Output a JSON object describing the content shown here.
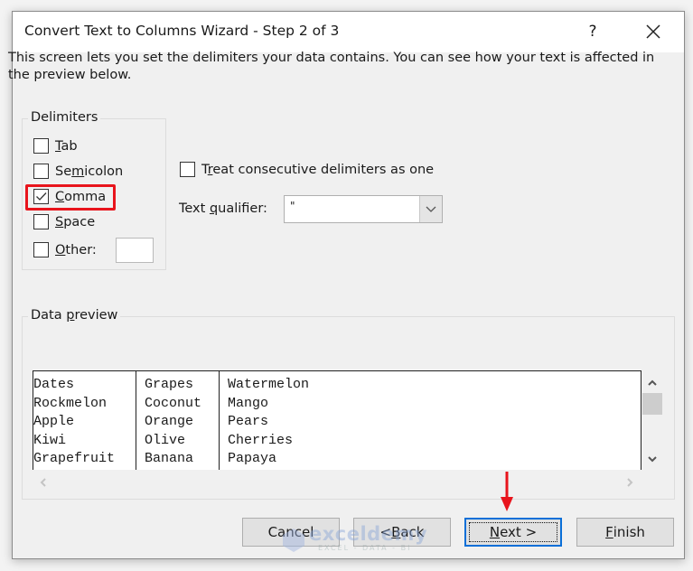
{
  "window": {
    "title": "Convert Text to Columns Wizard - Step 2 of 3",
    "help_label": "?",
    "close_icon": "close-icon"
  },
  "intro_text": "This screen lets you set the delimiters your data contains.  You can see how your text is affected in the preview below.",
  "delimiters": {
    "legend": "Delimiters",
    "items": [
      {
        "label_pre": "",
        "label_u": "T",
        "label_post": "ab",
        "checked": false
      },
      {
        "label_pre": "Se",
        "label_u": "m",
        "label_post": "icolon",
        "checked": false
      },
      {
        "label_pre": "",
        "label_u": "C",
        "label_post": "omma",
        "checked": true
      },
      {
        "label_pre": "",
        "label_u": "S",
        "label_post": "pace",
        "checked": false
      },
      {
        "label_pre": "",
        "label_u": "O",
        "label_post": "ther:",
        "checked": false
      }
    ],
    "other_value": ""
  },
  "options": {
    "consecutive": {
      "label_pre": "T",
      "label_u": "r",
      "label_post": "eat consecutive delimiters as one",
      "checked": false
    },
    "qualifier": {
      "label_pre": "Text ",
      "label_u": "q",
      "label_post": "ualifier:",
      "value": "\""
    }
  },
  "preview": {
    "legend_pre": "Data ",
    "legend_u": "p",
    "legend_post": "review",
    "columns": [
      [
        "Dates",
        "Rockmelon",
        "Apple",
        "Kiwi",
        "Grapefruit"
      ],
      [
        "Grapes",
        "Coconut",
        "Orange",
        "Olive",
        "Banana"
      ],
      [
        "Watermelon",
        "Mango",
        "Pears",
        "Cherries",
        "Papaya"
      ]
    ]
  },
  "buttons": {
    "cancel": "Cancel",
    "back_pre": "< ",
    "back_u": "B",
    "back_post": "ack",
    "next_u": "N",
    "next_post": "ext >",
    "finish_u": "F",
    "finish_post": "inish"
  },
  "annotation": {
    "highlight_color": "#e8141c",
    "arrow_color": "#e8141c"
  },
  "watermark": {
    "name": "exceldemy",
    "tagline": "EXCEL - DATA - BI"
  }
}
